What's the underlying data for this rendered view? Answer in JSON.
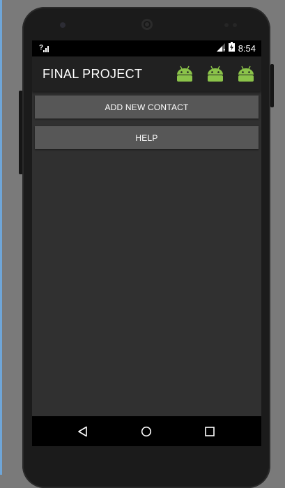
{
  "status_bar": {
    "time": "8:54",
    "icons": [
      "unknown-signal-icon",
      "cell-signal-icon",
      "battery-charging-icon"
    ]
  },
  "app_bar": {
    "title": "FINAL PROJECT",
    "action_icons": [
      "android-icon",
      "android-icon",
      "android-icon"
    ]
  },
  "buttons": {
    "add_contact": "ADD NEW CONTACT",
    "help": "HELP"
  },
  "nav_bar": {
    "keys": [
      "back-icon",
      "home-icon",
      "recents-icon"
    ]
  },
  "colors": {
    "screen_bg": "#303030",
    "action_bar_bg": "#212121",
    "button_bg": "#575757",
    "android_green": "#8bc34a"
  }
}
